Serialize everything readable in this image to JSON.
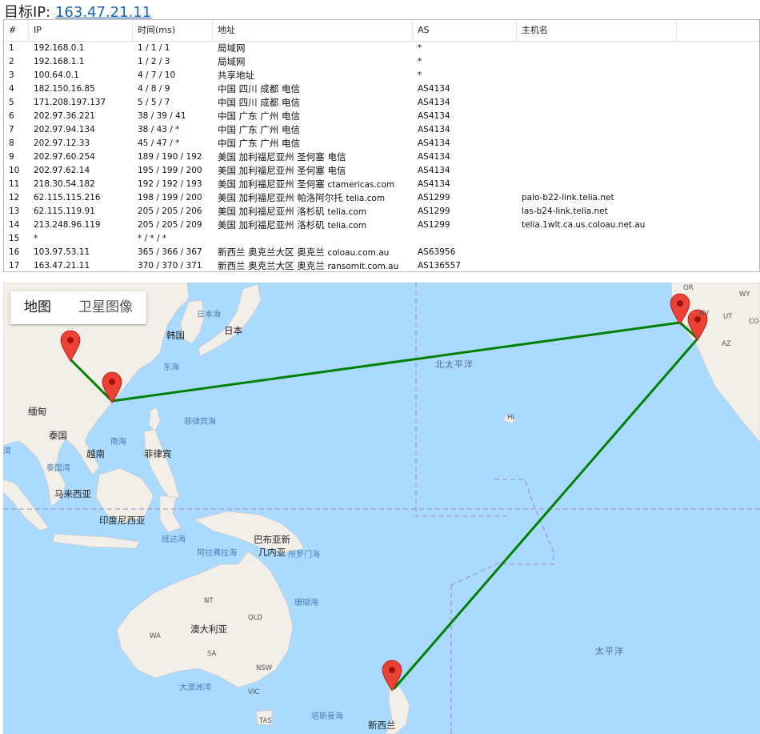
{
  "header": {
    "label": "目标IP:",
    "ip": "163.47.21.11"
  },
  "columns": [
    "#",
    "IP",
    "时间(ms)",
    "地址",
    "AS",
    "主机名"
  ],
  "rows": [
    {
      "num": "1",
      "ip": "192.168.0.1",
      "time": "1 / 1 / 1",
      "addr": "局域网",
      "domain": "",
      "as": "*",
      "host": ""
    },
    {
      "num": "2",
      "ip": "192.168.1.1",
      "time": "1 / 2 / 3",
      "addr": "局域网",
      "domain": "",
      "as": "*",
      "host": ""
    },
    {
      "num": "3",
      "ip": "100.64.0.1",
      "time": "4 / 7 / 10",
      "addr": "共享地址",
      "domain": "",
      "as": "*",
      "host": ""
    },
    {
      "num": "4",
      "ip": "182.150.16.85",
      "time": "4 / 8 / 9",
      "addr": "中国 四川 成都 电信",
      "domain": "",
      "as": "AS4134",
      "host": ""
    },
    {
      "num": "5",
      "ip": "171.208.197.137",
      "time": "5 / 5 / 7",
      "addr": "中国 四川 成都 电信",
      "domain": "",
      "as": "AS4134",
      "host": ""
    },
    {
      "num": "6",
      "ip": "202.97.36.221",
      "time": "38 / 39 / 41",
      "addr": "中国 广东 广州 电信",
      "domain": "",
      "as": "AS4134",
      "host": ""
    },
    {
      "num": "7",
      "ip": "202.97.94.134",
      "time": "38 / 43 / *",
      "addr": "中国 广东 广州 电信",
      "domain": "",
      "as": "AS4134",
      "host": ""
    },
    {
      "num": "8",
      "ip": "202.97.12.33",
      "time": "45 / 47 / *",
      "addr": "中国 广东 广州 电信",
      "domain": "",
      "as": "AS4134",
      "host": ""
    },
    {
      "num": "9",
      "ip": "202.97.60.254",
      "time": "189 / 190 / 192",
      "addr": "美国 加利福尼亚州 圣何塞 电信",
      "domain": "",
      "as": "AS4134",
      "host": ""
    },
    {
      "num": "10",
      "ip": "202.97.62.14",
      "time": "195 / 199 / 200",
      "addr": "美国 加利福尼亚州 圣何塞 电信",
      "domain": "",
      "as": "AS4134",
      "host": ""
    },
    {
      "num": "11",
      "ip": "218.30.54.182",
      "time": "192 / 192 / 193",
      "addr": "美国 加利福尼亚州 圣何塞",
      "domain": "ctamericas.com",
      "as": "AS4134",
      "host": ""
    },
    {
      "num": "12",
      "ip": "62.115.115.216",
      "time": "198 / 199 / 200",
      "addr": "美国 加利福尼亚州 帕洛阿尔托",
      "domain": "telia.com",
      "as": "AS1299",
      "host": "palo-b22-link.telia.net"
    },
    {
      "num": "13",
      "ip": "62.115.119.91",
      "time": "205 / 205 / 206",
      "addr": "美国 加利福尼亚州 洛杉矶",
      "domain": "telia.com",
      "as": "AS1299",
      "host": "las-b24-link.telia.net"
    },
    {
      "num": "14",
      "ip": "213.248.96.119",
      "time": "205 / 205 / 209",
      "addr": "美国 加利福尼亚州 洛杉矶",
      "domain": "telia.com",
      "as": "AS1299",
      "host": "telia.1wlt.ca.us.coloau.net.au"
    },
    {
      "num": "15",
      "ip": "*",
      "time": "* / * / *",
      "addr": "",
      "domain": "",
      "as": "",
      "host": ""
    },
    {
      "num": "16",
      "ip": "103.97.53.11",
      "time": "365 / 366 / 367",
      "addr": "新西兰 奥克兰大区 奥克兰",
      "domain": "coloau.com.au",
      "as": "AS63956",
      "host": ""
    },
    {
      "num": "17",
      "ip": "163.47.21.11",
      "time": "370 / 370 / 371",
      "addr": "新西兰 奥克兰大区 奥克兰",
      "domain": "ransomit.com.au",
      "as": "AS136557",
      "host": ""
    }
  ],
  "map": {
    "tabs": [
      "地图",
      "卫星图像"
    ],
    "active_tab": "地图",
    "colors": {
      "ocean": "#aadaff",
      "land": "#f2efe9",
      "route": "#008000",
      "marker": "#ea4335"
    },
    "labels": {
      "japan_sea": "日本海",
      "korea": "韩国",
      "japan": "日本",
      "east_sea": "东海",
      "philippine_sea": "菲律宾海",
      "myanmar": "缅甸",
      "thailand": "泰国",
      "bay": "湾",
      "south_sea": "南海",
      "vietnam": "越南",
      "philippines": "菲律宾",
      "gulf_thailand": "泰国湾",
      "malaysia": "马来西亚",
      "indonesia": "印度尼西亚",
      "banda": "班达海",
      "arafura": "阿拉弗拉海",
      "png": "巴布亚新几内亚",
      "solomon": "所罗门海",
      "coral": "珊瑚海",
      "australia": "澳大利亚",
      "nt": "NT",
      "qld": "QLD",
      "wa": "WA",
      "sa": "SA",
      "nsw": "NSW",
      "vic": "VIC",
      "tas": "TAS",
      "gab": "大澳洲湾",
      "tasman": "塔斯曼海",
      "nz": "新西兰",
      "npacific": "北太平洋",
      "pacific": "太平洋",
      "hi": "HI",
      "or": "OR",
      "nv": "NV",
      "ut": "UT",
      "az": "AZ",
      "wy": "WY",
      "co": "CO"
    }
  }
}
